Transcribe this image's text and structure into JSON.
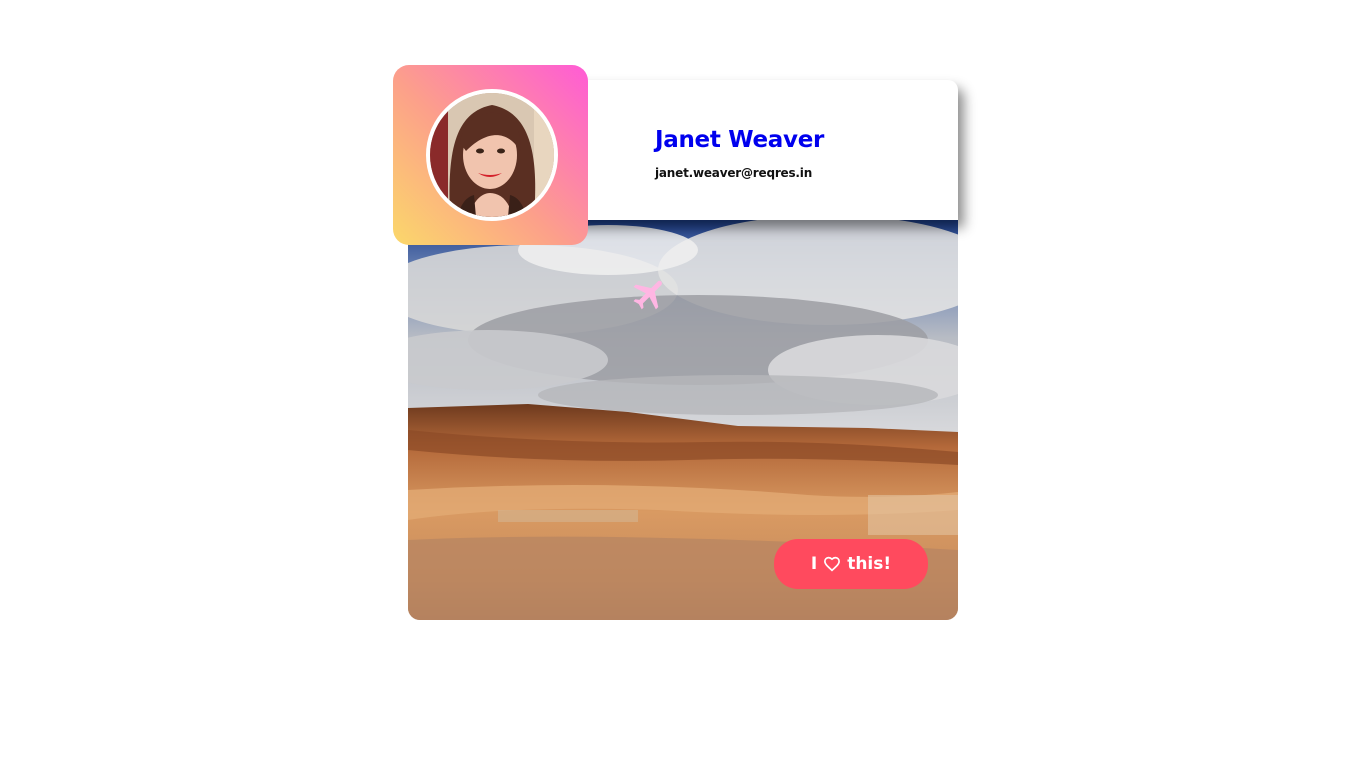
{
  "profile": {
    "name": "Janet Weaver",
    "email": "janet.weaver@reqres.in"
  },
  "like_button": {
    "prefix": "I",
    "icon": "heart-outline-icon",
    "suffix": "this!"
  },
  "overlay_icon": "airplane-icon",
  "colors": {
    "name": "#0000ee",
    "button": "#ff4a5e",
    "gradient": [
      "#fbd86a",
      "#fca08a",
      "#ff5bd6"
    ],
    "plane": "#ffb6e3"
  }
}
